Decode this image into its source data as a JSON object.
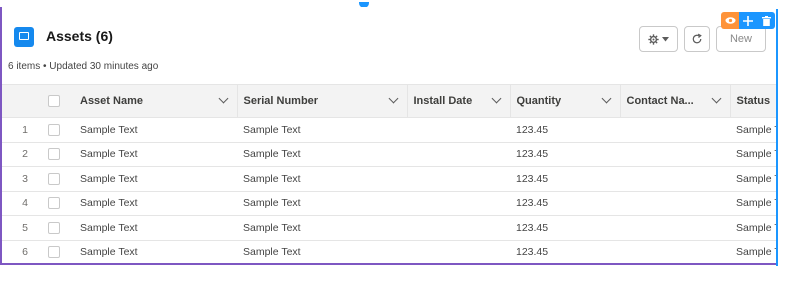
{
  "header": {
    "title": "Assets (6)",
    "subtitle": "6 items • Updated 30 minutes ago",
    "new_button": "New"
  },
  "toolbar": {
    "gear_icon": "gear-icon",
    "refresh_icon": "refresh-icon"
  },
  "builder_tools": [
    "eye-icon",
    "move-icon",
    "delete-icon"
  ],
  "columns": [
    "Asset Name",
    "Serial Number",
    "Install Date",
    "Quantity",
    "Contact Na...",
    "Status"
  ],
  "rows": [
    {
      "num": "1",
      "asset": "Sample Text",
      "serial": "Sample Text",
      "install": "",
      "quantity": "123.45",
      "contact": "",
      "status": "Sample Te"
    },
    {
      "num": "2",
      "asset": "Sample Text",
      "serial": "Sample Text",
      "install": "",
      "quantity": "123.45",
      "contact": "",
      "status": "Sample Te"
    },
    {
      "num": "3",
      "asset": "Sample Text",
      "serial": "Sample Text",
      "install": "",
      "quantity": "123.45",
      "contact": "",
      "status": "Sample Te"
    },
    {
      "num": "4",
      "asset": "Sample Text",
      "serial": "Sample Text",
      "install": "",
      "quantity": "123.45",
      "contact": "",
      "status": "Sample Te"
    },
    {
      "num": "5",
      "asset": "Sample Text",
      "serial": "Sample Text",
      "install": "",
      "quantity": "123.45",
      "contact": "",
      "status": "Sample Te"
    },
    {
      "num": "6",
      "asset": "Sample Text",
      "serial": "Sample Text",
      "install": "",
      "quantity": "123.45",
      "contact": "",
      "status": "Sample Te"
    }
  ],
  "colors": {
    "brand_icon": "#1589ee",
    "selection_blue": "#1b96ff",
    "selection_purple": "#7e57c2",
    "eye_orange": "#fe9339"
  }
}
